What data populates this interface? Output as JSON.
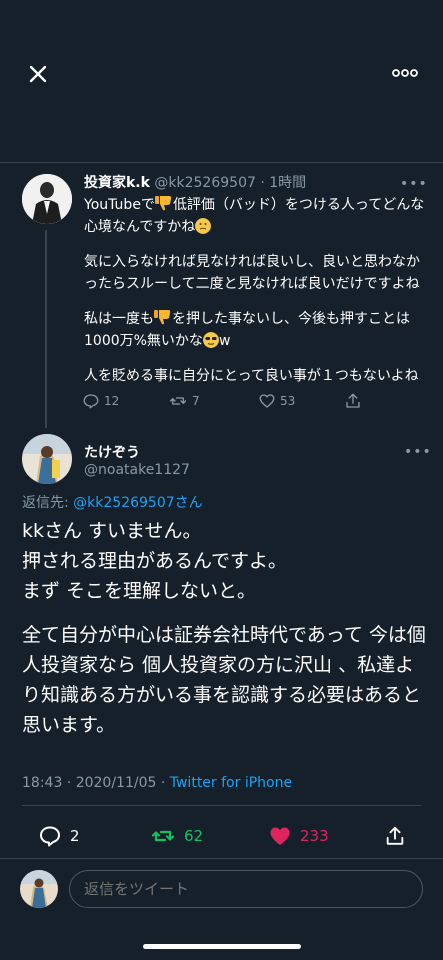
{
  "parent_tweet": {
    "display_name": "投資家k.k",
    "handle": "@kk25269507",
    "time": "· 1時間",
    "more": "•••",
    "lines": {
      "l1_a": "YouTubeで",
      "l1_b": "低評価（バッド）をつける人ってどんな心境なんですかね",
      "p2": "気に入らなければ見なければ良いし、良いと思わなかったらスルーして二度と見なければ良いだけですよね",
      "p3_a": "私は一度も",
      "p3_b": "を押した事ないし、今後も押すことは1000万%無いかな",
      "p3_c": "w",
      "p4": "人を貶める事に自分にとって良い事が１つもないよね"
    },
    "counts": {
      "replies": "12",
      "retweets": "7",
      "likes": "53"
    }
  },
  "main_tweet": {
    "display_name": "たけぞう",
    "handle": "@noatake1127",
    "more": "•••",
    "reply_prefix": "返信先: ",
    "reply_handle": "@kk25269507",
    "reply_suffix": "さん",
    "paragraph1": "kkさん すいません。\n押される理由があるんですよ。\nまず そこを理解しないと。",
    "paragraph2": "全て自分が中心は証券会社時代であって 今は個人投資家なら 個人投資家の方に沢山 、私達より知識ある方がいる事を認識する必要はあると思います。",
    "timestamp": "18:43 · 2020/11/05 · ",
    "source": "Twitter for iPhone",
    "counts": {
      "replies": "2",
      "retweets": "62",
      "likes": "233"
    }
  },
  "composer": {
    "placeholder": "返信をツイート"
  },
  "icons": {
    "close": "close-icon",
    "more": "more-icon",
    "reply": "reply-icon",
    "retweet": "retweet-icon",
    "like": "heart-icon",
    "share": "share-icon"
  },
  "colors": {
    "background": "#15202b",
    "accent": "#1da1f2",
    "retweet": "#17bf63",
    "like": "#e0245e",
    "muted": "#8899a6"
  }
}
